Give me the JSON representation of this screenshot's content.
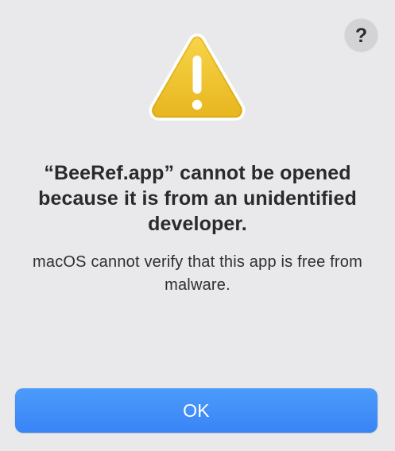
{
  "dialog": {
    "help_glyph": "?",
    "icon": "warning-triangle-icon",
    "title": "“BeeRef.app” cannot be opened because it is from an unidentified developer.",
    "message": "macOS cannot verify that this app is free from malware.",
    "ok_label": "OK"
  },
  "colors": {
    "background": "#e9e9eb",
    "accent": "#3b86f7",
    "warning": "#f2c52e"
  }
}
